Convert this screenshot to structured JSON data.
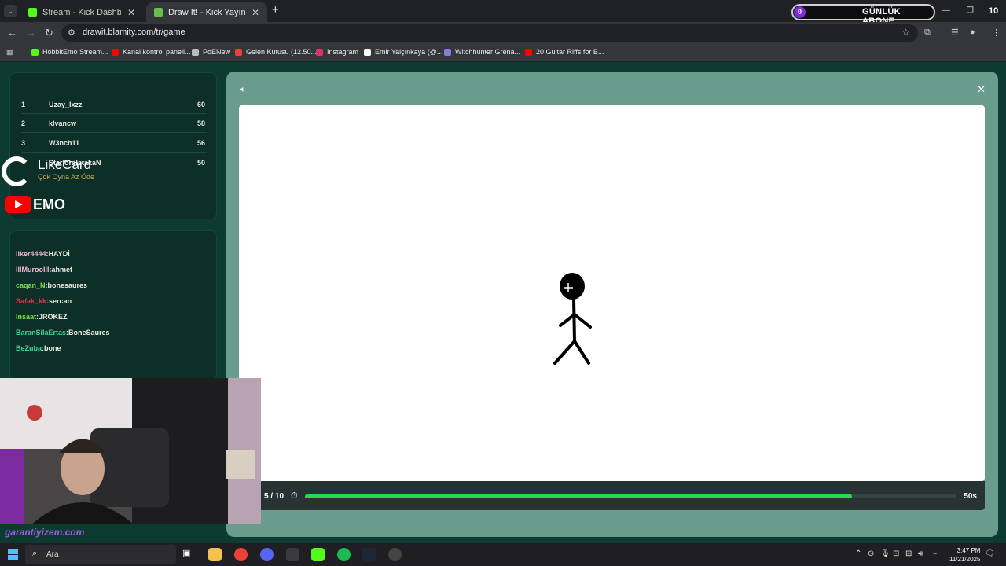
{
  "browser": {
    "tabs": [
      {
        "title": "Stream - Kick Dashboard",
        "favicon_color": "#53fc18",
        "active": false
      },
      {
        "title": "Draw It! - Kick Yayınları İçin Çizi",
        "favicon_color": "#6abf4b",
        "active": true
      }
    ],
    "url": "drawit.blamity.com/tr/game",
    "bookmarks": [
      {
        "label": "HobbitEmo Stream...",
        "color": "#53fc18"
      },
      {
        "label": "Kanal kontrol paneli...",
        "color": "#ff0000"
      },
      {
        "label": "PoENew",
        "color": "#bbbbbb"
      },
      {
        "label": "Gelen Kutusu (12.50...",
        "color": "#ea4335"
      },
      {
        "label": "Instagram",
        "color": "#e1306c"
      },
      {
        "label": "Emir Yalçınkaya (@...",
        "color": "#ffffff"
      },
      {
        "label": "Witchhunter Grena...",
        "color": "#8a7bd8"
      },
      {
        "label": "20 Guitar Riffs for B...",
        "color": "#ff0000"
      }
    ]
  },
  "overlay": {
    "abone_count_left": "0",
    "abone_label": "GÜNLÜK ABONE",
    "abone_count_right": "10",
    "likecard_name": "LikeCard",
    "likecard_tagline": "Çok Oyna  Az Öde",
    "yt_channel": "EMO",
    "garanti": "garantiyizem.com"
  },
  "leaderboard": [
    {
      "rank": "1",
      "name": "Uzay_lxzz",
      "score": "60"
    },
    {
      "rank": "2",
      "name": "klvancw",
      "score": "58"
    },
    {
      "rank": "3",
      "name": "W3nch11",
      "score": "56"
    },
    {
      "rank": "",
      "name": "StarlordlstakaN",
      "score": "50"
    }
  ],
  "chat": [
    {
      "user": "ilker4444",
      "text": "HAYDİ",
      "color": "#f4b8d0"
    },
    {
      "user": "lllMuroolll",
      "text": "ahmet",
      "color": "#f4b8d0"
    },
    {
      "user": "caqan_N",
      "text": "bonesaures",
      "color": "#7be04f"
    },
    {
      "user": "Safak_kk",
      "text": "sercan",
      "color": "#e0344f"
    },
    {
      "user": "Insaat",
      "text": "JROKEZ",
      "color": "#7be04f"
    },
    {
      "user": "BaranSilaErtas",
      "text": "BoneSaures",
      "color": "#43d19e"
    },
    {
      "user": "BeZuba",
      "text": "bone",
      "color": "#43d19e"
    }
  ],
  "game": {
    "round_text": "5 / 10",
    "time_remaining": "50s",
    "progress": 0.84
  },
  "taskbar": {
    "search_placeholder": "Ara",
    "time": "3:47 PM",
    "date": "11/21/2025"
  }
}
